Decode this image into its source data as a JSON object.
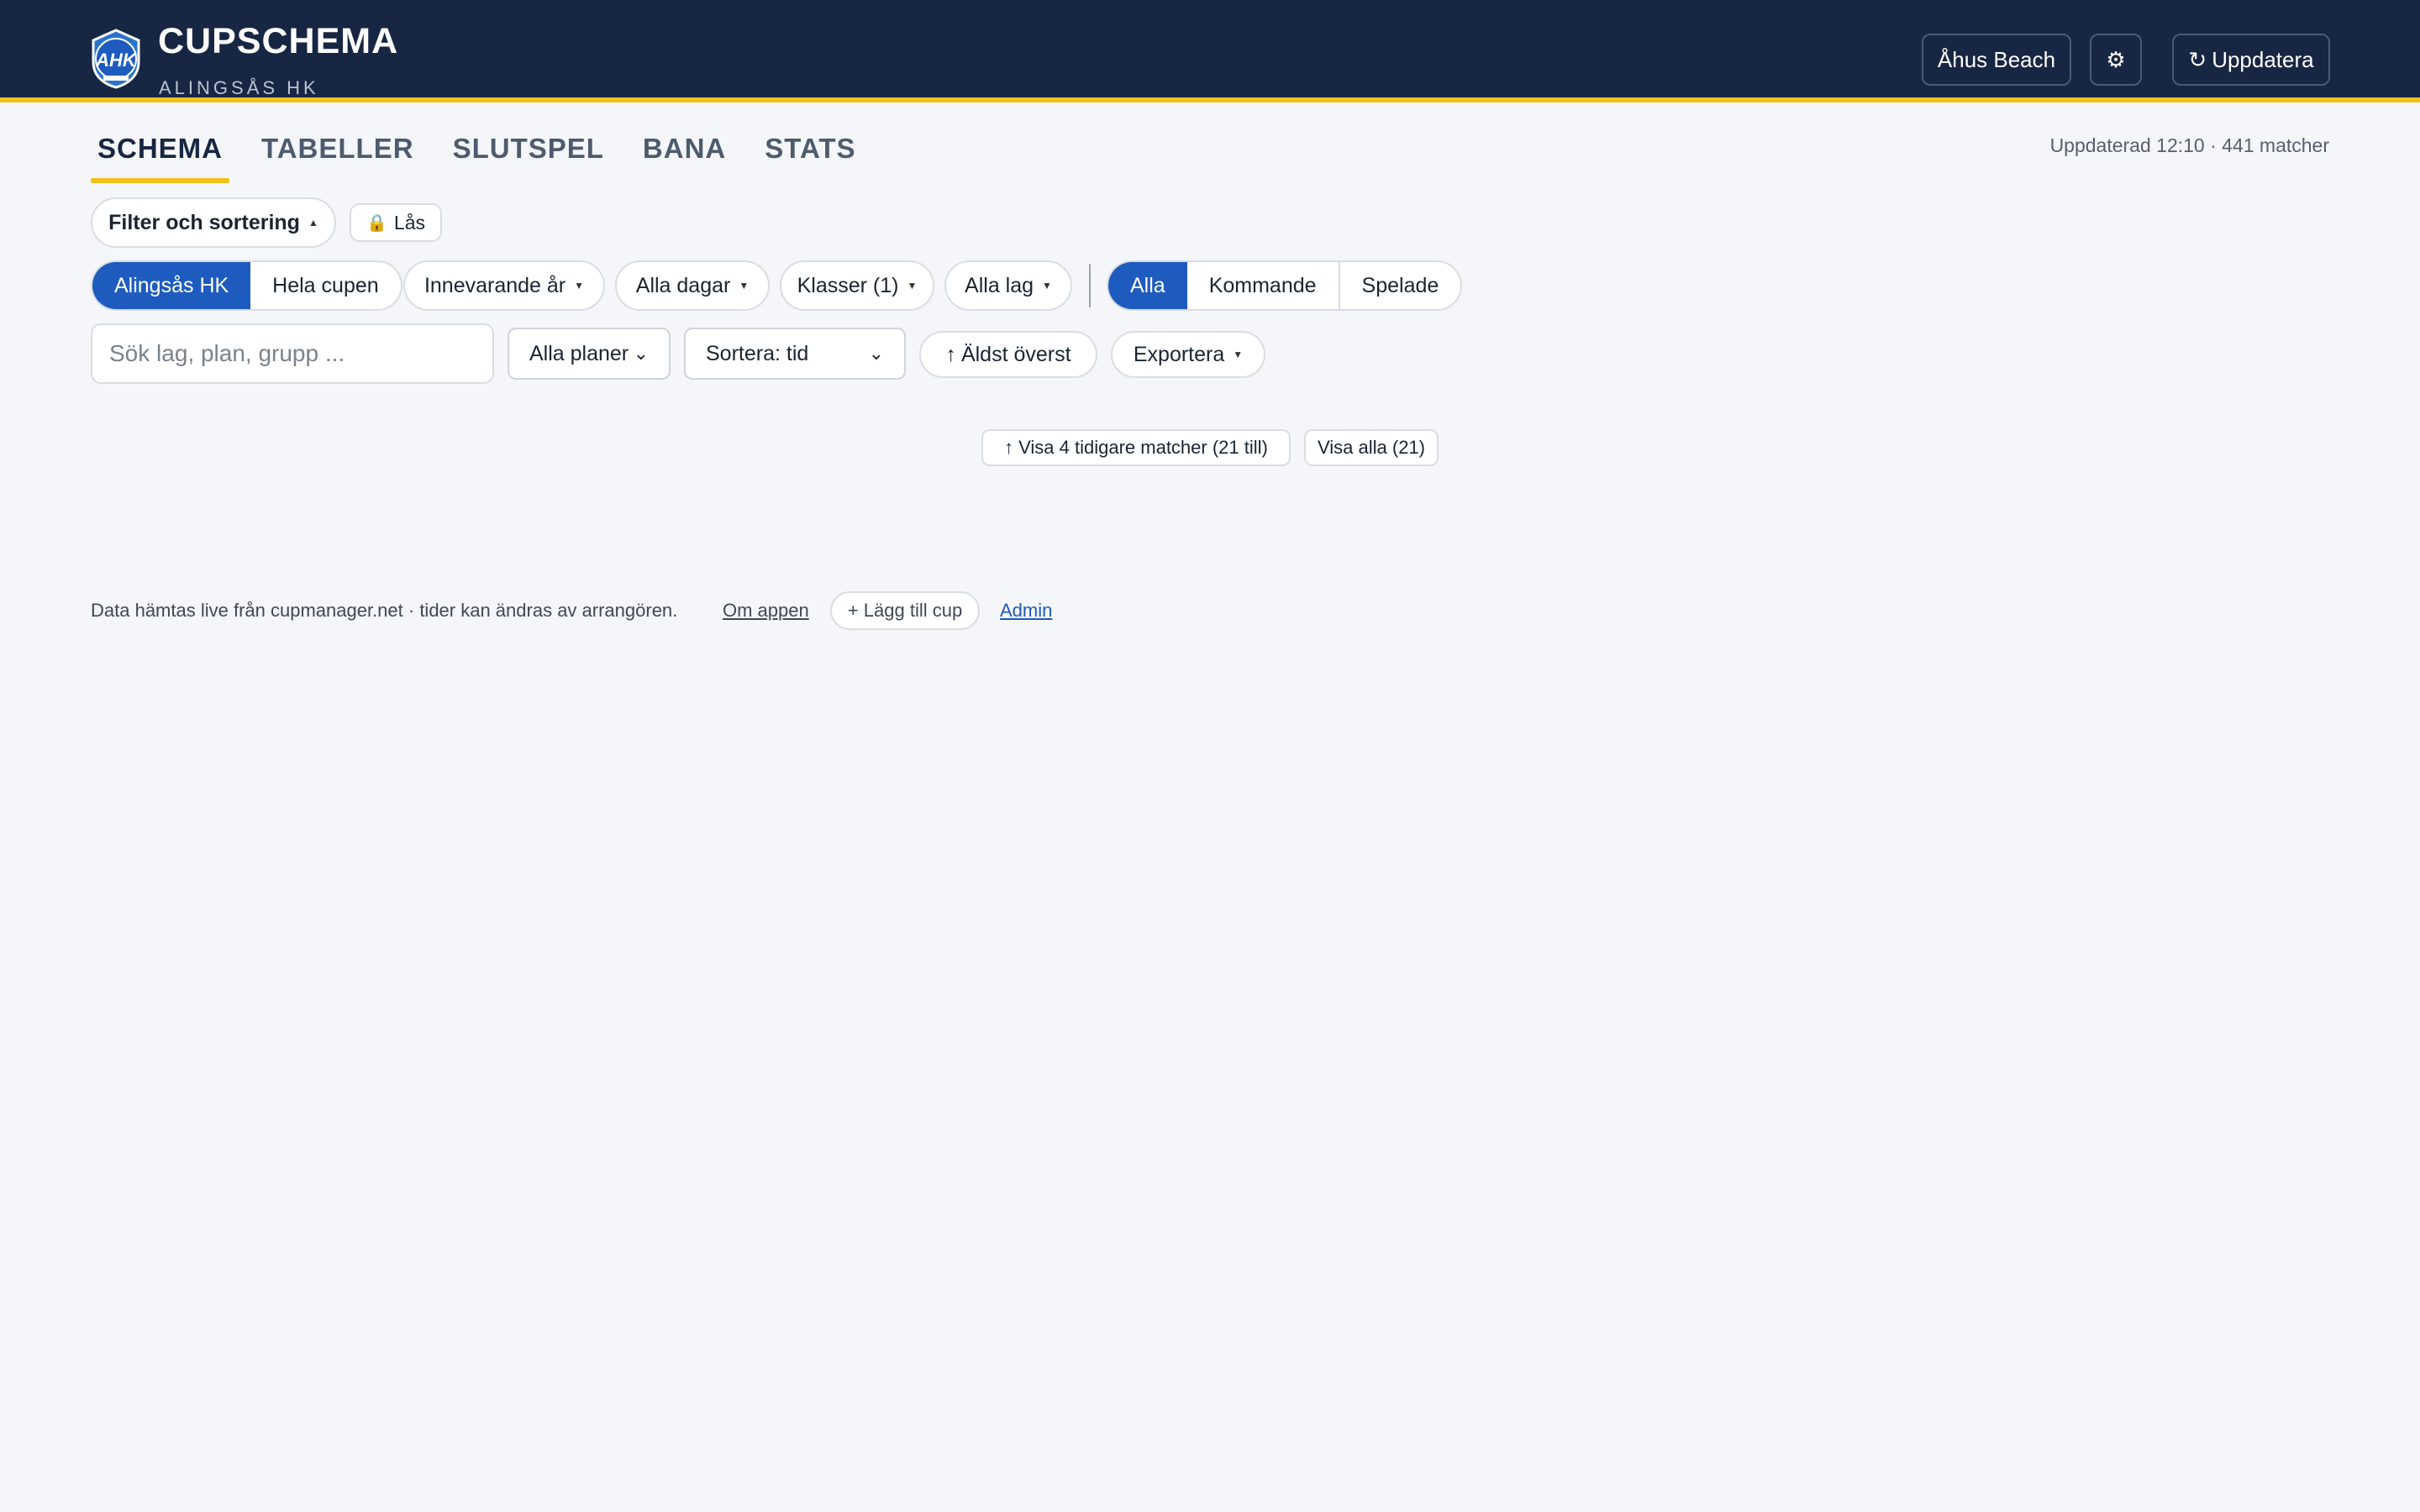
{
  "header": {
    "logo_text": "AHK",
    "title": "CUPSCHEMA",
    "subtitle": "ALINGSÅS HK",
    "cup_button": "Åhus Beach",
    "settings_icon": "gear-icon",
    "update_button": "Uppdatera",
    "update_icon": "refresh-icon",
    "colors": {
      "background": "#172642",
      "accent": "#f2c21b"
    }
  },
  "tabs": [
    {
      "label": "SCHEMA",
      "active": true
    },
    {
      "label": "TABELLER",
      "active": false
    },
    {
      "label": "SLUTSPEL",
      "active": false
    },
    {
      "label": "BANA",
      "active": false
    },
    {
      "label": "STATS",
      "active": false
    }
  ],
  "status": {
    "updated_text": "Uppdaterad 12:10 · 441 matcher"
  },
  "filters": {
    "toggle_label": "Filter och sortering",
    "lock_label": "Lås",
    "lock_icon": "lock-icon",
    "scope": [
      {
        "label": "Alingsås HK",
        "active": true
      },
      {
        "label": "Hela cupen",
        "active": false
      }
    ],
    "year_label": "Innevarande år",
    "days_label": "Alla dagar",
    "classes_label": "Klasser (1)",
    "teams_label": "Alla lag",
    "match_status": [
      {
        "label": "Alla",
        "active": true
      },
      {
        "label": "Kommande",
        "active": false
      },
      {
        "label": "Spelade",
        "active": false
      }
    ],
    "search_placeholder": "Sök lag, plan, grupp ...",
    "fields_select": "Alla planer",
    "sort_select": "Sortera: tid",
    "order_label": "Äldst överst",
    "export_label": "Exportera",
    "accent_color": "#1e5bbf"
  },
  "matches": {
    "show_earlier_label": "Visa 4 tidigare matcher (21 till)",
    "show_all_label": "Visa alla (21)"
  },
  "footer": {
    "note": "Data hämtas live från cupmanager.net · tider kan ändras av arrangören.",
    "about_link": "Om appen",
    "add_cup_label": "+ Lägg till cup",
    "admin_link": "Admin"
  }
}
